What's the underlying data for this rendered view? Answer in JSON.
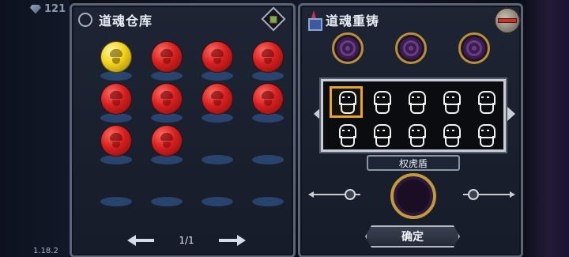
{
  "status": {
    "gems": "121",
    "version": "1.18.2"
  },
  "left_panel": {
    "title": "道魂仓库",
    "header_icon": "circle-icon",
    "filter_icon": "diamond-filter-icon",
    "orbs": [
      {
        "color": "gold"
      },
      {
        "color": "red"
      },
      {
        "color": "red"
      },
      {
        "color": "red"
      },
      {
        "color": "red"
      },
      {
        "color": "red"
      },
      {
        "color": "red"
      },
      {
        "color": "red"
      },
      {
        "color": "red"
      },
      {
        "color": "red"
      },
      {
        "color": "empty"
      },
      {
        "color": "empty"
      },
      {
        "color": "empty"
      },
      {
        "color": "empty"
      },
      {
        "color": "empty"
      },
      {
        "color": "empty"
      }
    ],
    "pager": {
      "page": "1/1"
    }
  },
  "right_panel": {
    "title": "道魂重铸",
    "hero_name": "权虎盾",
    "confirm_label": "确定",
    "colors": {
      "accent_gold": "#b89230",
      "orb_red": "#d71f1f",
      "orb_gold": "#f1d21b",
      "selection": "#e8a52a"
    }
  }
}
